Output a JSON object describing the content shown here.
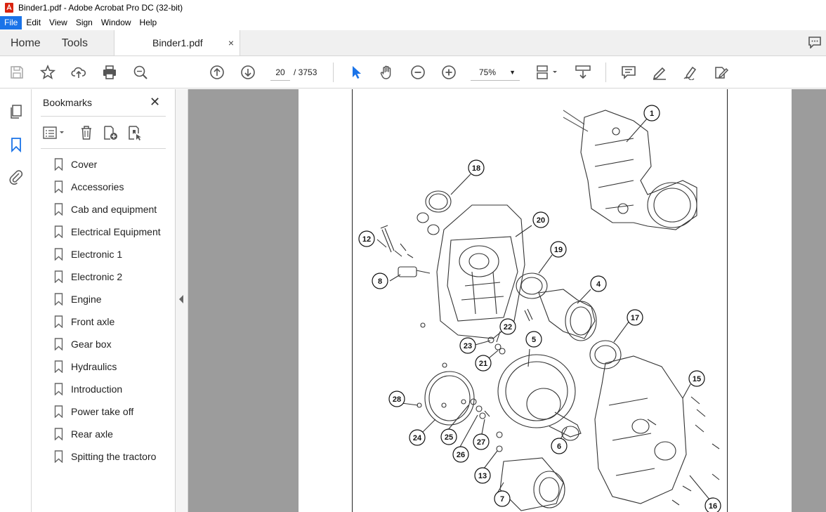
{
  "window": {
    "title": "Binder1.pdf - Adobe Acrobat Pro DC (32-bit)"
  },
  "menu": [
    "File",
    "Edit",
    "View",
    "Sign",
    "Window",
    "Help"
  ],
  "tabs": {
    "home": "Home",
    "tools": "Tools",
    "document": "Binder1.pdf",
    "close": "×"
  },
  "toolbar": {
    "page_current": "20",
    "page_total": "/ 3753",
    "zoom": "75%"
  },
  "bookmarks": {
    "header": "Bookmarks",
    "close": "✕",
    "items": [
      "Cover",
      "Accessories",
      "Cab and equipment",
      "Electrical Equipment",
      "Electronic 1",
      "Electronic 2",
      "Engine",
      "Front axle",
      "Gear box",
      "Hydraulics",
      "Introduction",
      "Power take off",
      "Rear axle",
      "Spitting the tractoro"
    ]
  },
  "diagram": {
    "callouts": [
      "1",
      "18",
      "20",
      "19",
      "12",
      "8",
      "4",
      "17",
      "22",
      "23",
      "21",
      "5",
      "15",
      "28",
      "24",
      "25",
      "26",
      "27",
      "13",
      "6",
      "7",
      "16"
    ]
  },
  "colors": {
    "accent": "#1a73e8",
    "viewer_bg": "#9c9c9c",
    "icon": "#555555"
  }
}
